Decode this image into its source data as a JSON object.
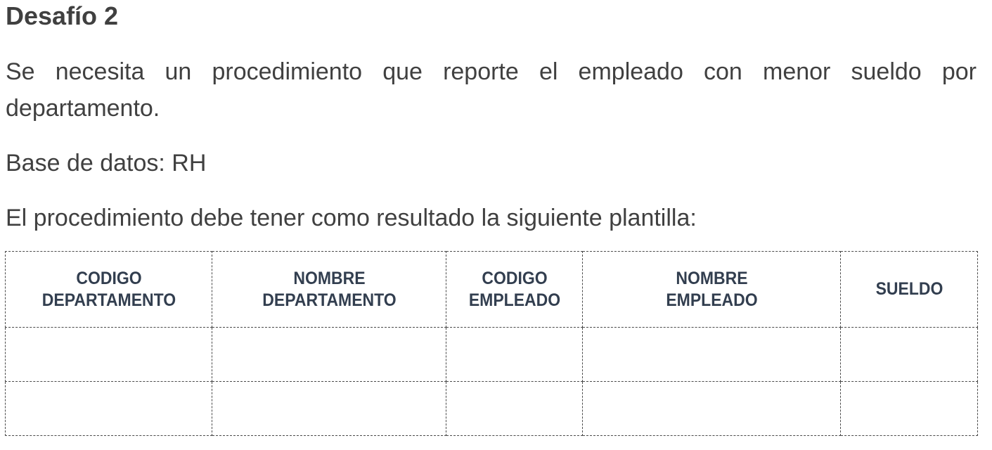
{
  "title": "Desafío 2",
  "paragraphs": {
    "intro": "Se necesita un procedimiento que reporte el empleado con menor sueldo por departamento.",
    "database": "Base de datos: RH",
    "template_intro": "El procedimiento debe tener como resultado la siguiente plantilla:"
  },
  "table": {
    "headers": [
      {
        "line1": "CODIGO",
        "line2": "DEPARTAMENTO"
      },
      {
        "line1": "NOMBRE",
        "line2": "DEPARTAMENTO"
      },
      {
        "line1": "CODIGO",
        "line2": "EMPLEADO"
      },
      {
        "line1": "NOMBRE",
        "line2": "EMPLEADO"
      },
      {
        "line1": "SUELDO",
        "line2": ""
      }
    ],
    "rows": [
      [
        "",
        "",
        "",
        "",
        ""
      ],
      [
        "",
        "",
        "",
        "",
        ""
      ]
    ]
  }
}
